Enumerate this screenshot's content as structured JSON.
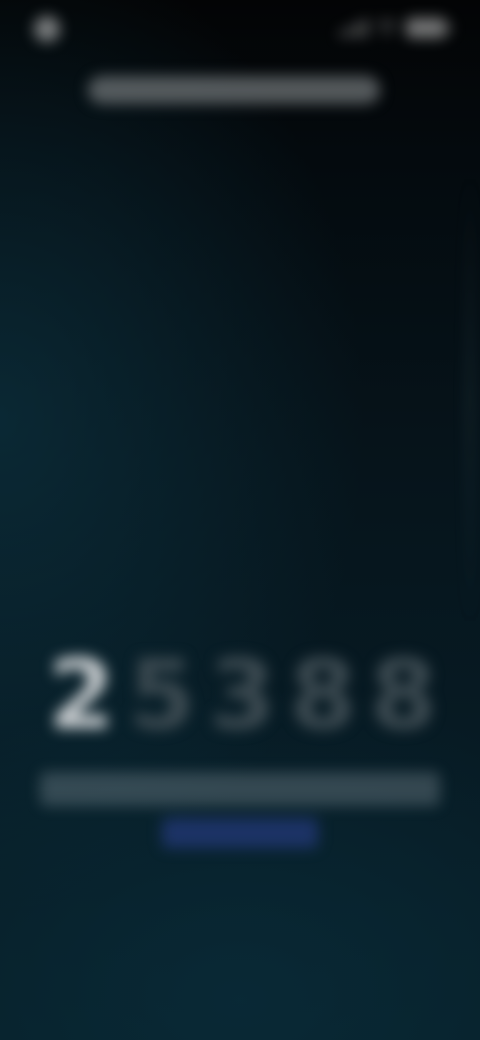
{
  "status_bar": {
    "time": "",
    "icons": [
      "signal-icon",
      "wifi-icon",
      "battery-icon"
    ]
  },
  "top_banner": {
    "text": ""
  },
  "counter": {
    "digits": [
      "2",
      "5",
      "3",
      "8",
      "8"
    ],
    "dim_indices": [
      1,
      2,
      3,
      4
    ]
  },
  "caption": {
    "text": ""
  },
  "link": {
    "label": ""
  },
  "colors": {
    "background_top": "#030405",
    "background_bottom": "#072029",
    "digit_bright": "#c6cbce",
    "digit_dim": "#3d4b52",
    "link": "#6e88ff"
  }
}
